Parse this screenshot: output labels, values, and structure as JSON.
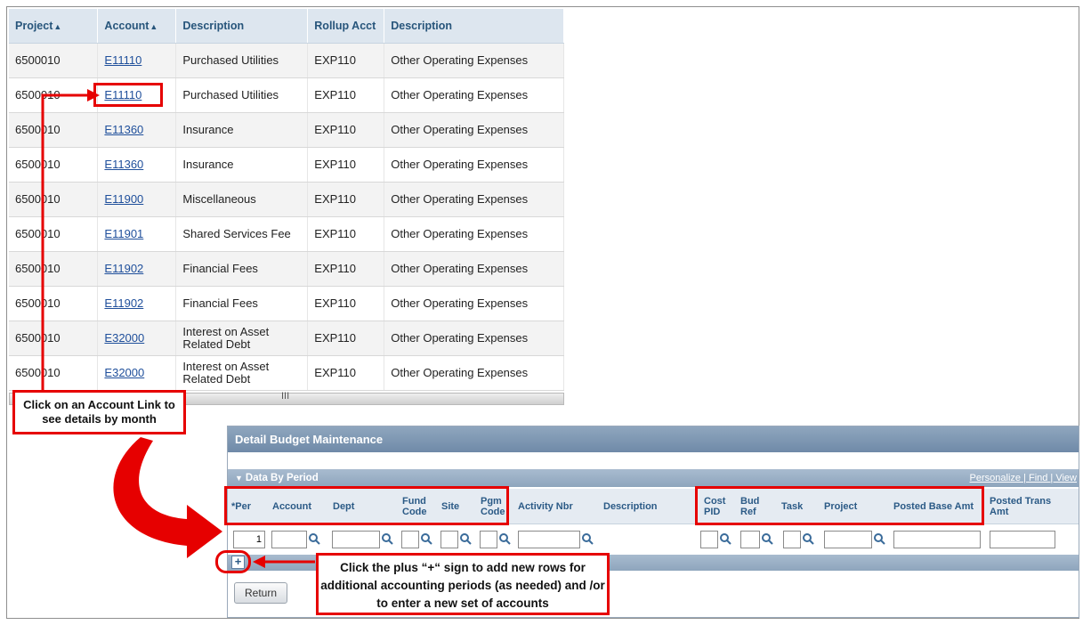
{
  "top_grid": {
    "headers": [
      "Project",
      "Account",
      "Description",
      "Rollup Acct",
      "Description"
    ],
    "rows": [
      [
        "6500010",
        "E11110",
        "Purchased Utilities",
        "EXP110",
        "Other Operating Expenses"
      ],
      [
        "6500010",
        "E11110",
        "Purchased Utilities",
        "EXP110",
        "Other Operating Expenses"
      ],
      [
        "6500010",
        "E11360",
        "Insurance",
        "EXP110",
        "Other Operating Expenses"
      ],
      [
        "6500010",
        "E11360",
        "Insurance",
        "EXP110",
        "Other Operating Expenses"
      ],
      [
        "6500010",
        "E11900",
        "Miscellaneous",
        "EXP110",
        "Other Operating Expenses"
      ],
      [
        "6500010",
        "E11901",
        "Shared Services Fee",
        "EXP110",
        "Other Operating Expenses"
      ],
      [
        "6500010",
        "E11902",
        "Financial Fees",
        "EXP110",
        "Other Operating Expenses"
      ],
      [
        "6500010",
        "E11902",
        "Financial Fees",
        "EXP110",
        "Other Operating Expenses"
      ],
      [
        "6500010",
        "E32000",
        "Interest on Asset Related Debt",
        "EXP110",
        "Other Operating Expenses"
      ],
      [
        "6500010",
        "E32000",
        "Interest on Asset Related Debt",
        "EXP110",
        "Other Operating Expenses"
      ]
    ],
    "sort_glyph": "▲",
    "scroll_grip": "III"
  },
  "callouts": {
    "account_link": "Click on an Account Link to see details by month",
    "plus_sign": "Click the plus “+“ sign to add new rows for additional accounting periods (as needed) and /or to enter a new set of accounts"
  },
  "detail": {
    "title": "Detail Budget Maintenance",
    "section_title": "Data By Period",
    "section_links": "Personalize | Find | View",
    "columns": {
      "per": "*Per",
      "account": "Account",
      "dept": "Dept",
      "fund_code": "Fund Code",
      "site": "Site",
      "pgm_code": "Pgm Code",
      "activity_nbr": "Activity Nbr",
      "description": "Description",
      "cost_pid": "Cost PID",
      "bud_ref": "Bud Ref",
      "task": "Task",
      "project": "Project",
      "posted_base_amt": "Posted Base Amt",
      "posted_trans_amt": "Posted Trans Amt"
    },
    "per_value": "1",
    "plus_label": "+",
    "return_label": "Return"
  },
  "colors": {
    "callout_red": "#e60000",
    "link_blue": "#1f4f9b",
    "header_blue": "#27557b"
  }
}
